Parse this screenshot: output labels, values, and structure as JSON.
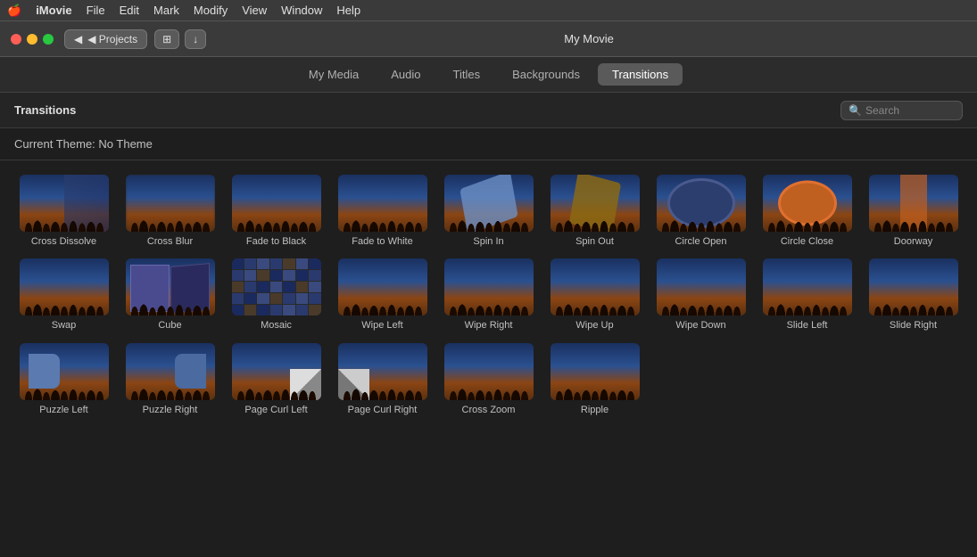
{
  "menubar": {
    "apple": "🍎",
    "app": "iMovie",
    "items": [
      "File",
      "Edit",
      "Mark",
      "Modify",
      "View",
      "Window",
      "Help"
    ]
  },
  "titlebar": {
    "projects_label": "◀ Projects",
    "movie_title": "My Movie"
  },
  "tabs": {
    "items": [
      {
        "id": "my-media",
        "label": "My Media"
      },
      {
        "id": "audio",
        "label": "Audio"
      },
      {
        "id": "titles",
        "label": "Titles"
      },
      {
        "id": "backgrounds",
        "label": "Backgrounds"
      },
      {
        "id": "transitions",
        "label": "Transitions",
        "active": true
      }
    ]
  },
  "content": {
    "title": "Transitions",
    "theme_label": "Current Theme: No Theme",
    "search_placeholder": "Search"
  },
  "transitions": [
    {
      "id": "cross-dissolve",
      "label": "Cross Dissolve",
      "class": "td-cross-dissolve"
    },
    {
      "id": "cross-blur",
      "label": "Cross Blur",
      "class": "td-cross-blur"
    },
    {
      "id": "fade-to-black",
      "label": "Fade to Black",
      "class": "td-fade-black"
    },
    {
      "id": "fade-to-white",
      "label": "Fade to White",
      "class": "td-fade-white"
    },
    {
      "id": "spin-in",
      "label": "Spin In",
      "class": "td-spin-in"
    },
    {
      "id": "spin-out",
      "label": "Spin Out",
      "class": "td-spin-out"
    },
    {
      "id": "circle-open",
      "label": "Circle Open",
      "class": "td-circle-open"
    },
    {
      "id": "circle-close",
      "label": "Circle Close",
      "class": "td-circle-close"
    },
    {
      "id": "doorway",
      "label": "Doorway",
      "class": "td-doorway"
    },
    {
      "id": "swap",
      "label": "Swap",
      "class": "td-swap"
    },
    {
      "id": "cube",
      "label": "Cube",
      "class": "td-cube"
    },
    {
      "id": "mosaic",
      "label": "Mosaic",
      "class": "td-mosaic"
    },
    {
      "id": "wipe-left",
      "label": "Wipe Left",
      "class": "td-wipe-left"
    },
    {
      "id": "wipe-right",
      "label": "Wipe Right",
      "class": "td-wipe-right"
    },
    {
      "id": "wipe-up",
      "label": "Wipe Up",
      "class": "td-wipe-up"
    },
    {
      "id": "wipe-down",
      "label": "Wipe Down",
      "class": "td-wipe-down"
    },
    {
      "id": "slide-left",
      "label": "Slide Left",
      "class": "td-slide-left"
    },
    {
      "id": "slide-right",
      "label": "Slide Right",
      "class": "td-slide-right"
    },
    {
      "id": "puzzle-left",
      "label": "Puzzle Left",
      "class": "td-puzzle-left"
    },
    {
      "id": "puzzle-right",
      "label": "Puzzle Right",
      "class": "td-puzzle-right"
    },
    {
      "id": "page-curl-left",
      "label": "Page Curl Left",
      "class": "td-page-curl-left"
    },
    {
      "id": "page-curl-right",
      "label": "Page Curl Right",
      "class": "td-page-curl-right"
    },
    {
      "id": "cross-zoom",
      "label": "Cross Zoom",
      "class": "td-cross-zoom"
    },
    {
      "id": "ripple",
      "label": "Ripple",
      "class": "td-ripple"
    }
  ]
}
